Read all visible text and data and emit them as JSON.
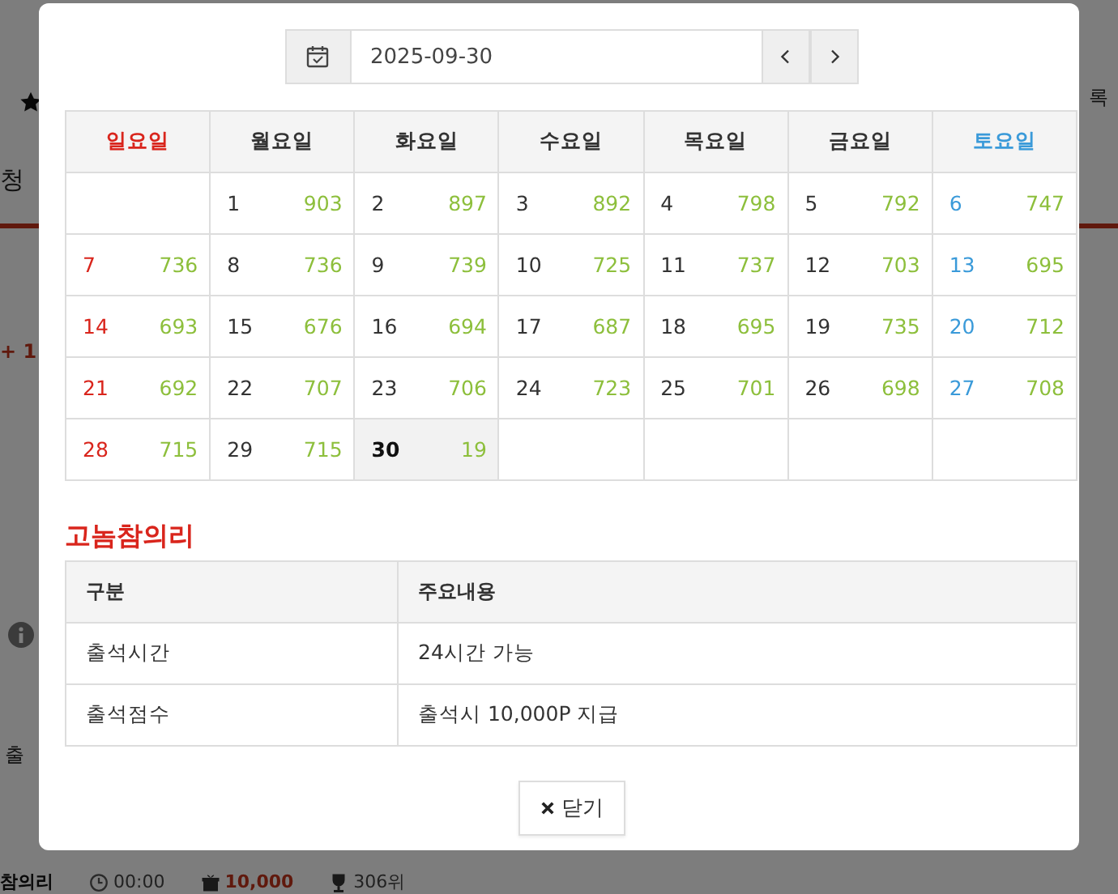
{
  "background": {
    "texts": [
      {
        "kind": "tab",
        "text": "청"
      },
      {
        "kind": "points",
        "text": "+ 1"
      },
      {
        "kind": "label",
        "text": "출"
      },
      {
        "kind": "side",
        "text": "록"
      }
    ],
    "footer": {
      "name": "참의리",
      "time": "00:00",
      "points": "10,000",
      "rank": "306위"
    }
  },
  "date_picker": {
    "value": "2025-09-30"
  },
  "calendar": {
    "weekdays": [
      {
        "label": "일요일",
        "color": "#d9251c"
      },
      {
        "label": "월요일",
        "color": "#333333"
      },
      {
        "label": "화요일",
        "color": "#333333"
      },
      {
        "label": "수요일",
        "color": "#333333"
      },
      {
        "label": "목요일",
        "color": "#333333"
      },
      {
        "label": "금요일",
        "color": "#333333"
      },
      {
        "label": "토요일",
        "color": "#3a9ad9"
      }
    ],
    "weeks": [
      [
        {
          "day": "1",
          "count": "903",
          "selected": false
        },
        {
          "day": "2",
          "count": "897",
          "selected": false
        },
        {
          "day": "3",
          "count": "892",
          "selected": false
        },
        {
          "day": "4",
          "count": "798",
          "selected": false
        },
        {
          "day": "5",
          "count": "792",
          "selected": false
        },
        {
          "day": "6",
          "count": "747",
          "selected": false
        }
      ],
      [
        {
          "day": "7",
          "count": "736",
          "selected": false
        },
        {
          "day": "8",
          "count": "736",
          "selected": false
        },
        {
          "day": "9",
          "count": "739",
          "selected": false
        },
        {
          "day": "10",
          "count": "725",
          "selected": false
        },
        {
          "day": "11",
          "count": "737",
          "selected": false
        },
        {
          "day": "12",
          "count": "703",
          "selected": false
        },
        {
          "day": "13",
          "count": "695",
          "selected": false
        }
      ],
      [
        {
          "day": "14",
          "count": "693",
          "selected": false
        },
        {
          "day": "15",
          "count": "676",
          "selected": false
        },
        {
          "day": "16",
          "count": "694",
          "selected": false
        },
        {
          "day": "17",
          "count": "687",
          "selected": false
        },
        {
          "day": "18",
          "count": "695",
          "selected": false
        },
        {
          "day": "19",
          "count": "735",
          "selected": false
        },
        {
          "day": "20",
          "count": "712",
          "selected": false
        }
      ],
      [
        {
          "day": "21",
          "count": "692",
          "selected": false
        },
        {
          "day": "22",
          "count": "707",
          "selected": false
        },
        {
          "day": "23",
          "count": "706",
          "selected": false
        },
        {
          "day": "24",
          "count": "723",
          "selected": false
        },
        {
          "day": "25",
          "count": "701",
          "selected": false
        },
        {
          "day": "26",
          "count": "698",
          "selected": false
        },
        {
          "day": "27",
          "count": "708",
          "selected": false
        }
      ],
      [
        {
          "day": "28",
          "count": "715",
          "selected": false
        },
        {
          "day": "29",
          "count": "715",
          "selected": false
        },
        {
          "day": "30",
          "count": "19",
          "selected": true
        }
      ]
    ]
  },
  "info": {
    "title": "고놈참의리",
    "columns": [
      "구분",
      "주요내용"
    ],
    "rows": [
      [
        "출석시간",
        "24시간 가능"
      ],
      [
        "출석점수",
        "출석시 10,000P 지급"
      ]
    ]
  },
  "close_button": {
    "label": "닫기"
  }
}
